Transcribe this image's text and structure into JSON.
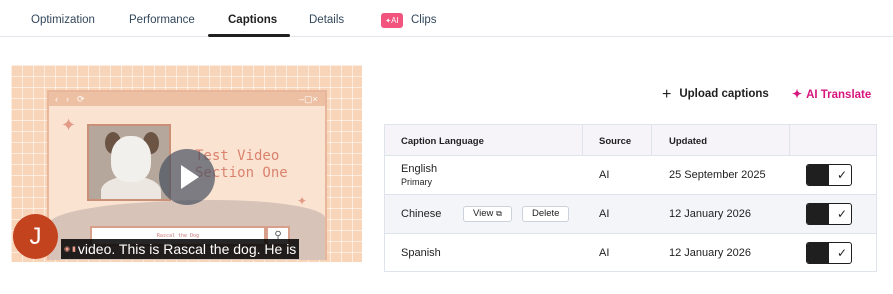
{
  "tabs": [
    {
      "label": "Optimization"
    },
    {
      "label": "Performance"
    },
    {
      "label": "Captions",
      "active": true
    },
    {
      "label": "Details"
    },
    {
      "label": "Clips",
      "badge": "AI"
    }
  ],
  "video": {
    "slide_title": "Test Video Section One",
    "search_text": "Rascal the Dog",
    "avatar_initial": "J",
    "caption_text": "video. This is Rascal the dog. He is"
  },
  "actions": {
    "upload_label": "Upload captions",
    "translate_label": "AI Translate"
  },
  "table": {
    "headers": [
      "Caption Language",
      "Source",
      "Updated"
    ],
    "rows": [
      {
        "language": "English",
        "sub": "Primary",
        "source": "AI",
        "updated": "25 September 2025",
        "enabled": true
      },
      {
        "language": "Chinese",
        "sub": "",
        "source": "AI",
        "updated": "12 January 2026",
        "enabled": true,
        "view_label": "View",
        "delete_label": "Delete"
      },
      {
        "language": "Spanish",
        "sub": "",
        "source": "AI",
        "updated": "12 January 2026",
        "enabled": true
      }
    ]
  },
  "colors": {
    "accent": "#d6167e",
    "ai_badge": "#f2547d",
    "avatar": "#c4431f"
  },
  "icons": [
    "play-icon",
    "search-icon",
    "plus-icon",
    "sparkle-icon",
    "external-link-icon",
    "check-icon"
  ]
}
